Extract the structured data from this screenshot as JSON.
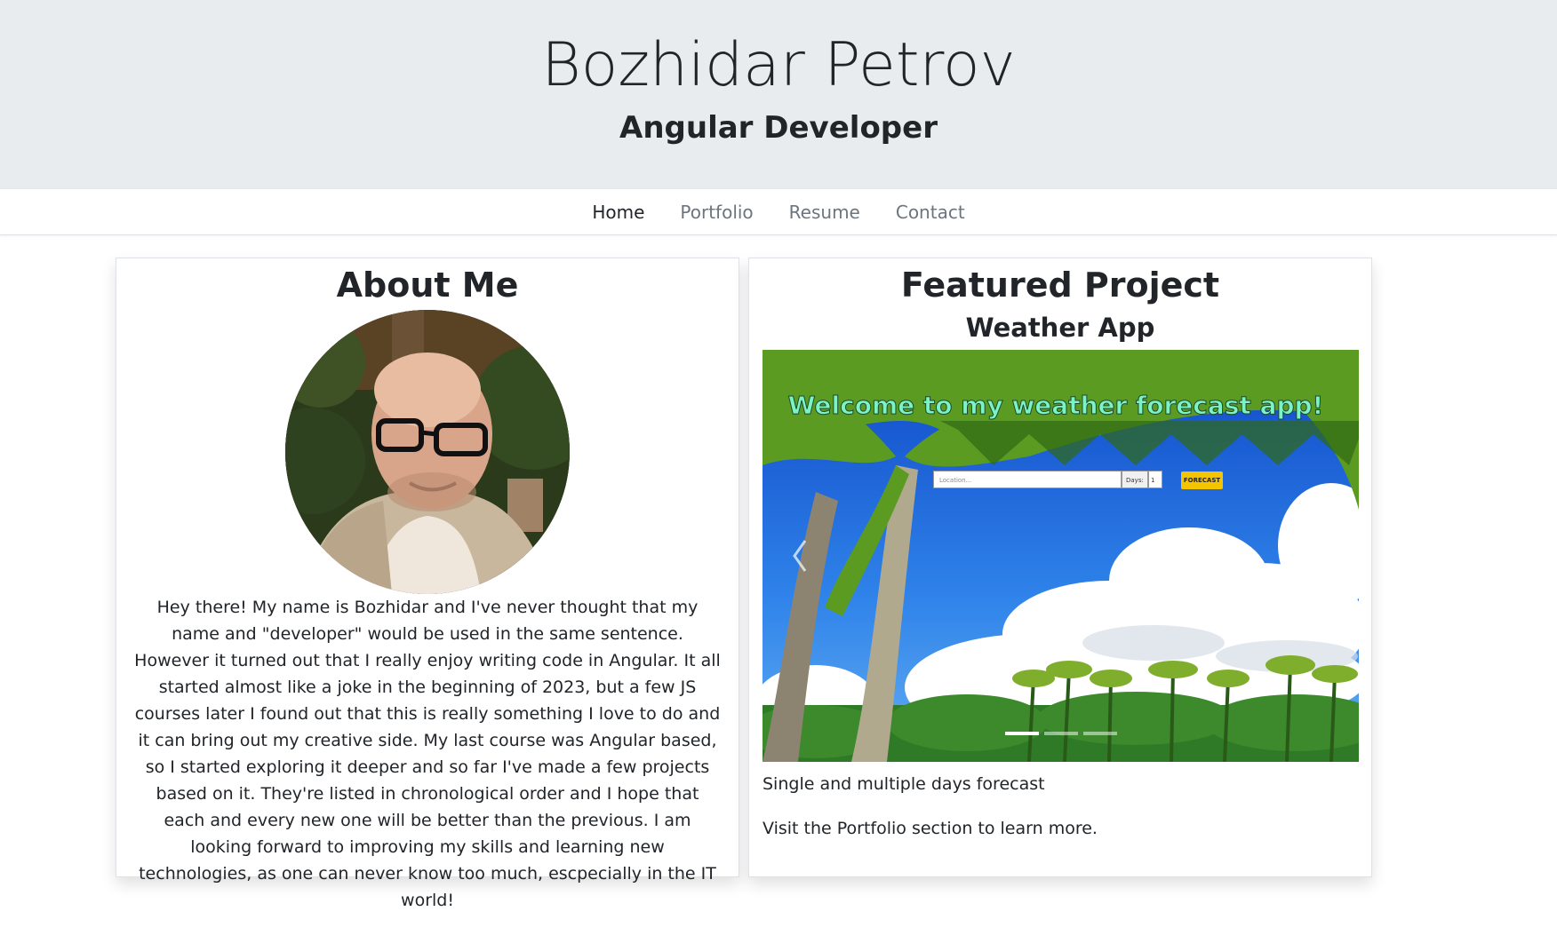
{
  "header": {
    "name": "Bozhidar Petrov",
    "role": "Angular Developer"
  },
  "nav": {
    "items": [
      {
        "label": "Home",
        "active": true
      },
      {
        "label": "Portfolio",
        "active": false
      },
      {
        "label": "Resume",
        "active": false
      },
      {
        "label": "Contact",
        "active": false
      }
    ]
  },
  "about": {
    "title": "About Me",
    "text": "Hey there! My name is Bozhidar and I've never thought that my name and \"developer\" would be used in the same sentence. However it turned out that I really enjoy writing code in Angular. It all started almost like a joke in the beginning of 2023, but a few JS courses later I found out that this is really something I love to do and it can bring out my creative side. My last course was Angular based, so I started exploring it deeper and so far I've made a few projects based on it. They're listed in chronological order and I hope that each and every new one will be better than the previous. I am looking forward to improving my skills and learning new technologies, as one can never know too much, escpecially in the IT world!"
  },
  "project": {
    "title": "Featured Project",
    "subtitle": "Weather App",
    "slide": {
      "headline": "Welcome to my weather forecast app!",
      "location_placeholder": "Location...",
      "days_label": "Days:",
      "days_value": "1",
      "button_label": "FORECAST"
    },
    "carousel": {
      "slide_count": 3,
      "active_index": 0,
      "prev_icon": "chevron-left-icon",
      "next_icon": "chevron-right-icon"
    },
    "description": "Single and multiple days forecast",
    "more": "Visit the Portfolio section to learn more."
  },
  "colors": {
    "hero_bg": "#e9ecef",
    "text": "#212529",
    "nav_inactive": "#6c757d",
    "headline": "#7cf3c4",
    "forecast_button": "#f5c400"
  }
}
